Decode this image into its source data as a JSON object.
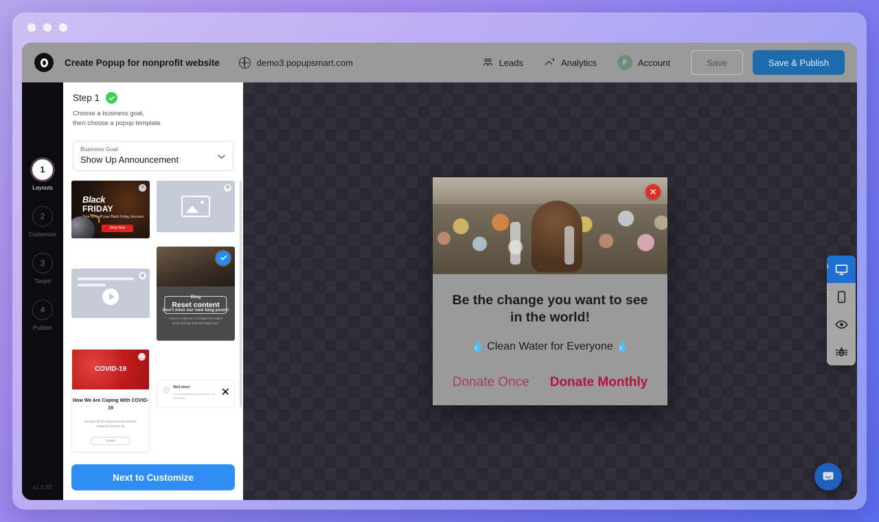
{
  "window": {
    "traffic_lights": [
      "close",
      "minimize",
      "maximize"
    ]
  },
  "header": {
    "logo_icon": "popupsmart-logo-icon",
    "app_title": "Create Popup for nonprofit website",
    "globe_icon": "globe-icon",
    "domain": "demo3.popupsmart.com",
    "links": [
      {
        "label": "Leads",
        "icon": "leads-icon"
      },
      {
        "label": "Analytics",
        "icon": "analytics-icon"
      }
    ],
    "account": {
      "label": "Account",
      "avatar_initial": "F",
      "avatar_color": "#6e8f77"
    },
    "save_label": "Save",
    "publish_label": "Save & Publish",
    "publish_color": "#1e6cb0"
  },
  "rail": {
    "steps": [
      {
        "number": "1",
        "label": "Layouts",
        "active": true
      },
      {
        "number": "2",
        "label": "Customize",
        "active": false
      },
      {
        "number": "3",
        "label": "Target",
        "active": false
      },
      {
        "number": "4",
        "label": "Publish",
        "active": false
      }
    ],
    "version": "v1.5.92"
  },
  "panel": {
    "step_title": "Step 1",
    "step_complete_icon": "check-circle-icon",
    "step_description": "Choose a business goal,\nthen choose a popup template",
    "business_goal": {
      "label": "Business Goal",
      "value": "Show Up Announcement",
      "chevron_icon": "chevron-down-icon"
    },
    "templates": [
      {
        "name": "black-friday",
        "title_top": "Black",
        "title_bottom": "FRIDAY",
        "body": "Take 60% off your Black Friday discount now!",
        "button": "Shop Now",
        "selected": false
      },
      {
        "name": "image-placeholder",
        "selected": false
      },
      {
        "name": "video-template",
        "selected": false
      },
      {
        "name": "blog-announcement",
        "eyebrow": "Blog",
        "title": "Don't miss our new blog posts!",
        "body": "I have a collection of budget decoration ideas and tips that will inspire you.",
        "overlay_button": "Reset content",
        "selected": true
      },
      {
        "name": "covid-19",
        "badge": "COVID-19",
        "title": "How We Are Coping With COVID-19",
        "body": "We take all the necessary precautions related to COVID-19.",
        "button": "Details",
        "selected": false
      },
      {
        "name": "well-done-notification",
        "title": "Well done!",
        "body": "You successfully subscribed to our newsletter.",
        "selected": false
      },
      {
        "name": "virus-banner",
        "selected": false
      }
    ],
    "next_button": "Next to Customize"
  },
  "popup": {
    "close_icon": "close-icon",
    "hero_alt": "children-holding-water-bottles",
    "headline": "Be the change you want to see in the world!",
    "subline": "Clean Water for Everyone",
    "drop_icon": "water-drop-icon",
    "cta_once": "Donate Once",
    "cta_monthly": "Donate Monthly",
    "cta_once_color": "#b03a4e",
    "cta_monthly_color": "#b8123d"
  },
  "devbar": {
    "items": [
      {
        "name": "desktop-view",
        "icon": "desktop-icon",
        "active": true,
        "indicator": "green"
      },
      {
        "name": "mobile-view",
        "icon": "mobile-icon",
        "active": false,
        "indicator": "red"
      },
      {
        "name": "preview",
        "icon": "eye-icon",
        "active": false,
        "indicator": "none"
      },
      {
        "name": "debug",
        "icon": "bug-icon",
        "active": false,
        "indicator": "none"
      }
    ]
  },
  "chat": {
    "icon": "chat-bubble-icon"
  }
}
